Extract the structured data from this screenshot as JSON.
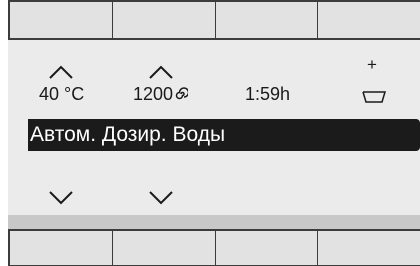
{
  "display": {
    "temperature": "40 °C",
    "spin_speed": "1200",
    "spin_icon": "spiral-icon",
    "duration": "1:59h",
    "detergent_plus": "+",
    "detergent_icon": "cup-icon",
    "selected_option": "Автом. Дозир. Воды"
  },
  "icons": {
    "up": "chevron-up-icon",
    "down": "chevron-down-icon"
  }
}
